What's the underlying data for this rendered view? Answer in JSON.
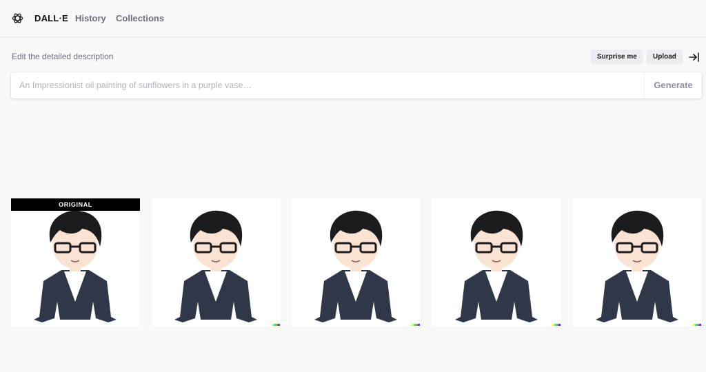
{
  "header": {
    "brand": "DALL·E",
    "nav": [
      {
        "label": "History"
      },
      {
        "label": "Collections"
      }
    ]
  },
  "editor": {
    "label": "Edit the detailed description",
    "surprise_label": "Surprise me",
    "upload_label": "Upload",
    "placeholder": "An Impressionist oil painting of sunflowers in a purple vase…",
    "generate_label": "Generate"
  },
  "results": {
    "original_badge": "ORIGINAL",
    "images": [
      {
        "kind": "original",
        "alt": "Original cartoon portrait of a man with glasses"
      },
      {
        "kind": "variation",
        "alt": "Variation 1"
      },
      {
        "kind": "variation",
        "alt": "Variation 2"
      },
      {
        "kind": "variation",
        "alt": "Variation 3"
      },
      {
        "kind": "variation",
        "alt": "Variation 4"
      }
    ]
  },
  "colors": {
    "signature": [
      "#ffff66",
      "#42ffff",
      "#51da4c",
      "#ff6e3c",
      "#3c46ff"
    ],
    "hair": "#1c1c1f",
    "jacket": "#2f3748",
    "skin": "#fbe3d3"
  }
}
